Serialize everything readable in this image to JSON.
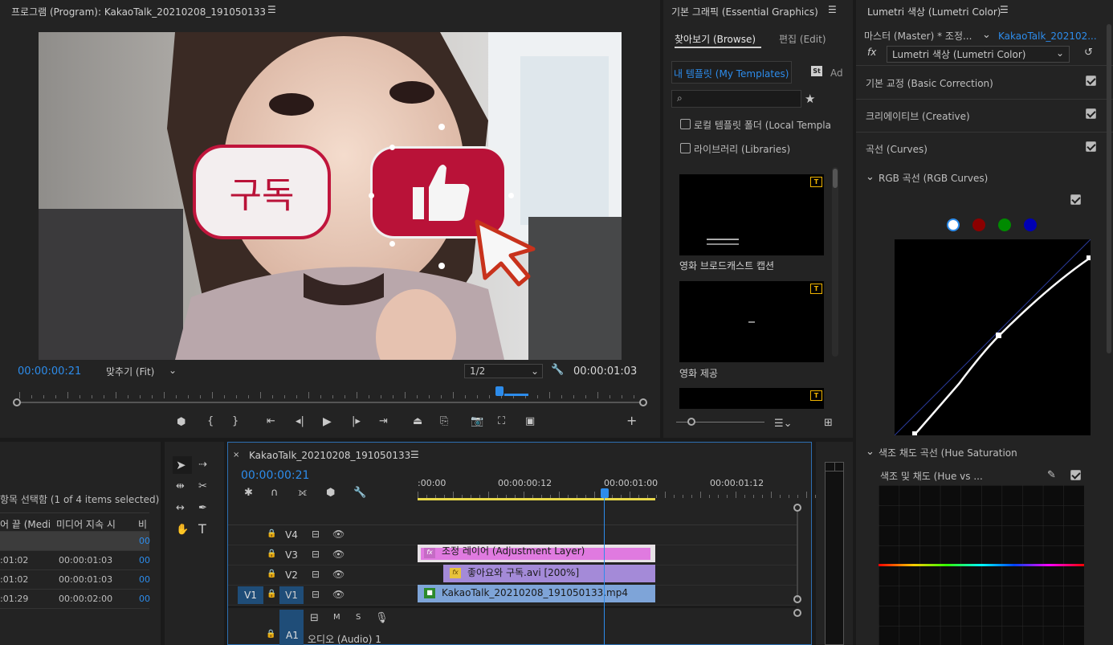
{
  "program_monitor": {
    "title": "프로그램 (Program): KakaoTalk_20210208_191050133",
    "timecode": "00:00:00:21",
    "fit_label": "맞추기 (Fit)",
    "resolution": "1/2",
    "duration": "00:00:01:03",
    "playhead_position": 0.77
  },
  "overlay": {
    "subscribe_text": "구독"
  },
  "essential_graphics": {
    "title": "기본 그래픽 (Essential Graphics)",
    "tab_browse": "찾아보기 (Browse)",
    "tab_edit": "편집 (Edit)",
    "subtab_my_templates": "내 템플릿 (My Templates)",
    "subtab_adobe_stock_short": "Ad",
    "stock_badge": "St",
    "local_templates_label": "로컬 템플릿 폴더 (Local Templa",
    "libraries_label": "라이브러리 (Libraries)",
    "templates": [
      {
        "name": "영화 브로드캐스트 캡션",
        "badge": "T"
      },
      {
        "name": "영화 제공",
        "badge": "T"
      },
      {
        "name": "",
        "badge": "T"
      }
    ]
  },
  "lumetri": {
    "title": "Lumetri 색상 (Lumetri Color)",
    "master_label": "마스터 (Master) * 조정...",
    "clip_label": "KakaoTalk_202102...",
    "fx_label": "fx",
    "effect_select": "Lumetri 색상 (Lumetri Color)",
    "sections": [
      {
        "label": "기본 교정 (Basic Correction)",
        "checked": true
      },
      {
        "label": "크리에이티브 (Creative)",
        "checked": true
      },
      {
        "label": "곡선 (Curves)",
        "checked": true
      }
    ],
    "rgb_curves_label": "RGB 곡선 (RGB Curves)",
    "hue_saturation_label": "색조 채도 곡선 (Hue Saturation",
    "hue_vs_sat_label": "색조 및 채도 (Hue vs ...",
    "channel_colors": [
      "#ffffff",
      "#8b0000",
      "#008a00",
      "#0000b4"
    ]
  },
  "project_panel": {
    "selection_text": "항목 선택함 (1 of 4 items selected)",
    "col_media_end": "어 끝 (Medi",
    "col_media_duration": "미디어 지속 시",
    "col_video": "비",
    "rows": [
      {
        "end": "",
        "duration": "",
        "video": "00"
      },
      {
        "end": ":01:02",
        "duration": "00:00:01:03",
        "video": "00"
      },
      {
        "end": ":01:02",
        "duration": "00:00:01:03",
        "video": "00"
      },
      {
        "end": ":01:29",
        "duration": "00:00:02:00",
        "video": "00"
      }
    ]
  },
  "timeline": {
    "sequence_name": "KakaoTalk_20210208_191050133",
    "timecode": "00:00:00:21",
    "ruler_labels": [
      ":00:00",
      "00:00:00:12",
      "00:00:01:00",
      "00:00:01:12"
    ],
    "tracks": [
      {
        "name": "V4"
      },
      {
        "name": "V3"
      },
      {
        "name": "V2"
      },
      {
        "name": "V1",
        "source": "V1"
      }
    ],
    "audio_tracks": [
      {
        "name": "A1",
        "label": "오디오 (Audio) 1",
        "m": "M",
        "s": "S"
      }
    ],
    "clips": {
      "adjustment": "조정 레이어 (Adjustment Layer)",
      "graphic": "좋아요와 구독.avi [200%]",
      "video": "KakaoTalk_20210208_191050133.mp4"
    },
    "fx_badge": "fx"
  },
  "colors": {
    "accent_blue": "#2d8ceb",
    "adjustment_clip": "#e07ae0",
    "graphic_clip": "#a48ad8",
    "video_clip": "#7ea4d8",
    "subscribe_red": "#c0153c"
  }
}
